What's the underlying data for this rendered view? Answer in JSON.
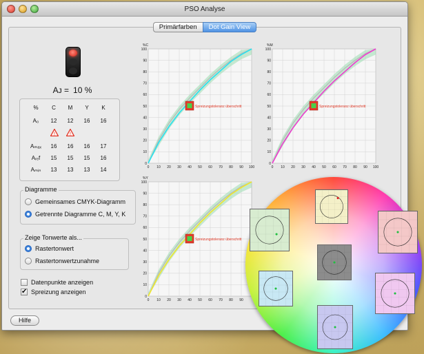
{
  "window": {
    "title": "PSO Analyse"
  },
  "tabs": [
    {
      "label": "Primärfarben",
      "active": false
    },
    {
      "label": "Dot Gain View",
      "active": true
    }
  ],
  "status": {
    "af_label": "Aᴊ =",
    "af_value": "10 %",
    "light": "red"
  },
  "table": {
    "headers": [
      "%",
      "C",
      "M",
      "Y",
      "K"
    ],
    "rows": [
      {
        "label": "A₀",
        "values": [
          "12",
          "12",
          "16",
          "16"
        ]
      },
      {
        "label": "Aₘₐₓ",
        "values": [
          "16",
          "16",
          "16",
          "17"
        ]
      },
      {
        "label": "Aᵣₑf",
        "values": [
          "15",
          "15",
          "15",
          "16"
        ]
      },
      {
        "label": "Aₘᵢₙ",
        "values": [
          "13",
          "13",
          "13",
          "14"
        ]
      }
    ],
    "warnings_on": [
      "C",
      "M"
    ]
  },
  "diagramme": {
    "title": "Diagramme",
    "options": [
      {
        "label": "Gemeinsames CMYK-Diagramm",
        "selected": false
      },
      {
        "label": "Getrennte Diagramme C, M, Y, K",
        "selected": true
      }
    ]
  },
  "tonwerte": {
    "title": "Zeige Tonwerte als...",
    "options": [
      {
        "label": "Rastertonwert",
        "selected": true
      },
      {
        "label": "Rastertonwertzunahme",
        "selected": false
      }
    ]
  },
  "checks": [
    {
      "label": "Datenpunkte anzeigen",
      "checked": false
    },
    {
      "label": "Spreizung anzeigen",
      "checked": true
    }
  ],
  "help_label": "Hilfe",
  "warning_text": "Spreizungstoleranz überschritt",
  "chart_data": [
    {
      "type": "line",
      "ylabel": "%C",
      "xticks": [
        "0",
        "10",
        "20",
        "30",
        "40",
        "50",
        "60",
        "70",
        "80",
        "90",
        "100"
      ],
      "yticks": [
        "0",
        "10",
        "20",
        "30",
        "40",
        "50",
        "60",
        "70",
        "80",
        "90",
        "100"
      ],
      "ylim": [
        0,
        100
      ],
      "xlim": [
        0,
        100
      ],
      "series": [
        {
          "color": "#28e0f0",
          "x": [
            0,
            10,
            20,
            30,
            40,
            50,
            60,
            70,
            80,
            90,
            100
          ],
          "y": [
            0,
            18,
            32,
            44,
            54,
            64,
            73,
            81,
            89,
            95,
            100
          ]
        },
        {
          "color": "#b8b8b8",
          "x": [
            0,
            10,
            20,
            30,
            40,
            50,
            60,
            70,
            80,
            90,
            100
          ],
          "y": [
            0,
            20,
            35,
            47,
            57,
            66,
            75,
            83,
            90,
            96,
            100
          ]
        }
      ],
      "marker": {
        "x": 40,
        "y": 50
      }
    },
    {
      "type": "line",
      "ylabel": "%M",
      "xticks": [
        "0",
        "10",
        "20",
        "30",
        "40",
        "50",
        "60",
        "70",
        "80",
        "90",
        "100"
      ],
      "yticks": [
        "0",
        "10",
        "20",
        "30",
        "40",
        "50",
        "60",
        "70",
        "80",
        "90",
        "100"
      ],
      "ylim": [
        0,
        100
      ],
      "xlim": [
        0,
        100
      ],
      "series": [
        {
          "color": "#f03ad0",
          "x": [
            0,
            10,
            20,
            30,
            40,
            50,
            60,
            70,
            80,
            90,
            100
          ],
          "y": [
            0,
            17,
            31,
            43,
            53,
            63,
            72,
            80,
            88,
            95,
            100
          ]
        },
        {
          "color": "#b8b8b8",
          "x": [
            0,
            10,
            20,
            30,
            40,
            50,
            60,
            70,
            80,
            90,
            100
          ],
          "y": [
            0,
            20,
            35,
            47,
            57,
            66,
            75,
            83,
            90,
            96,
            100
          ]
        }
      ],
      "marker": {
        "x": 40,
        "y": 50
      }
    },
    {
      "type": "line",
      "ylabel": "%Y",
      "xticks": [
        "0",
        "10",
        "20",
        "30",
        "40",
        "50",
        "60",
        "70",
        "80",
        "90"
      ],
      "yticks": [
        "0",
        "10",
        "20",
        "30",
        "40",
        "50",
        "60",
        "70",
        "80",
        "90",
        "100"
      ],
      "ylim": [
        0,
        100
      ],
      "xlim": [
        0,
        100
      ],
      "series": [
        {
          "color": "#f0e62a",
          "x": [
            0,
            10,
            20,
            30,
            40,
            50,
            60,
            70,
            80,
            90,
            100
          ],
          "y": [
            0,
            18,
            32,
            44,
            54,
            64,
            73,
            81,
            89,
            95,
            100
          ]
        },
        {
          "color": "#b8b8b8",
          "x": [
            0,
            10,
            20,
            30,
            40,
            50,
            60,
            70,
            80,
            90,
            100
          ],
          "y": [
            0,
            20,
            35,
            47,
            57,
            66,
            75,
            83,
            90,
            96,
            100
          ]
        }
      ],
      "marker": {
        "x": 40,
        "y": 50
      }
    }
  ],
  "color_wheel": {
    "panels": [
      {
        "name": "panel-top",
        "bg": "#f4f0c8",
        "dot": "#e02020"
      },
      {
        "name": "panel-left",
        "bg": "#d8ecd0",
        "dot": "#20c040"
      },
      {
        "name": "panel-center",
        "bg": "#8c8c8c",
        "dot": "#20c040"
      },
      {
        "name": "panel-right",
        "bg": "#f4c8c8",
        "dot": "#20c040"
      },
      {
        "name": "panel-lower-left",
        "bg": "#c8e8f4",
        "dot": "#20c040"
      },
      {
        "name": "panel-lower-right",
        "bg": "#f0c8f0",
        "dot": "#20c040"
      },
      {
        "name": "panel-bottom",
        "bg": "#c8c8f0",
        "dot": "#20c040"
      }
    ]
  }
}
